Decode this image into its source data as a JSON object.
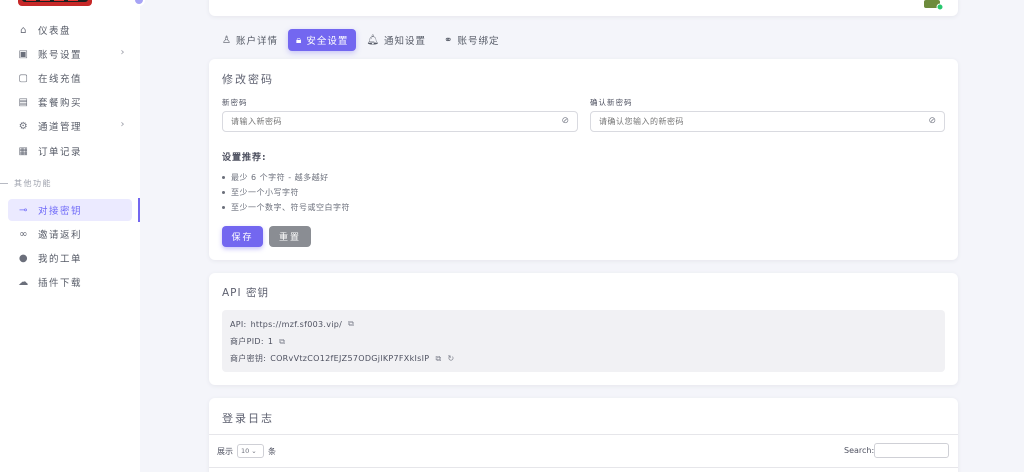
{
  "sidebar": {
    "items": [
      {
        "icon": "home-icon",
        "glyph": "⌂",
        "label": "仪表盘",
        "chevron": ""
      },
      {
        "icon": "account-icon",
        "glyph": "▣",
        "label": "账号设置",
        "chevron": "›"
      },
      {
        "icon": "recharge-icon",
        "glyph": "▢",
        "label": "在线充值",
        "chevron": ""
      },
      {
        "icon": "package-icon",
        "glyph": "▤",
        "label": "套餐购买",
        "chevron": ""
      },
      {
        "icon": "gear-icon",
        "glyph": "⚙",
        "label": "通道管理",
        "chevron": "›"
      },
      {
        "icon": "order-icon",
        "glyph": "▦",
        "label": "订单记录",
        "chevron": ""
      }
    ],
    "section_label": "其他功能",
    "other_items": [
      {
        "icon": "key-icon",
        "glyph": "⊸",
        "label": "对接密钥",
        "active": true
      },
      {
        "icon": "link-icon",
        "glyph": "∞",
        "label": "邀请返利",
        "active": false
      },
      {
        "icon": "chat-icon",
        "glyph": "●",
        "label": "我的工单",
        "active": false
      },
      {
        "icon": "cloud-download-icon",
        "glyph": "☁",
        "label": "插件下载",
        "active": false
      }
    ]
  },
  "tabs": [
    {
      "icon": "user-icon",
      "glyph": "♙",
      "label": "账户详情",
      "active": false
    },
    {
      "icon": "lock-icon",
      "glyph": "🔒︎",
      "label": "安全设置",
      "active": true
    },
    {
      "icon": "bell-icon",
      "glyph": "🔔︎",
      "label": "通知设置",
      "active": false
    },
    {
      "icon": "link-icon",
      "glyph": "⚭",
      "label": "账号绑定",
      "active": false
    }
  ],
  "password": {
    "title": "修改密码",
    "new_label": "新密码",
    "new_placeholder": "请输入新密码",
    "confirm_label": "确认新密码",
    "confirm_placeholder": "请确认您输入的新密码",
    "rec_title": "设置推荐:",
    "recommendations": [
      "最少 6 个字符 - 越多越好",
      "至少一个小写字符",
      "至少一个数字、符号或空白字符"
    ],
    "save_label": "保存",
    "reset_label": "重置"
  },
  "api": {
    "title": "API 密钥",
    "api_label": "API:",
    "api_value": "https://mzf.sf003.vip/",
    "pid_label": "商户PID:",
    "pid_value": "1",
    "key_label": "商户密钥:",
    "key_value": "CORvVtzCO12fEJZ57ODGjlKP7FXkIsIP"
  },
  "log": {
    "title": "登录日志",
    "show_label": "展示",
    "show_value": "10",
    "entries_label": "条",
    "search_label": "Search:"
  },
  "colors": {
    "accent": "#7367f0",
    "reset": "#8a8d93"
  }
}
